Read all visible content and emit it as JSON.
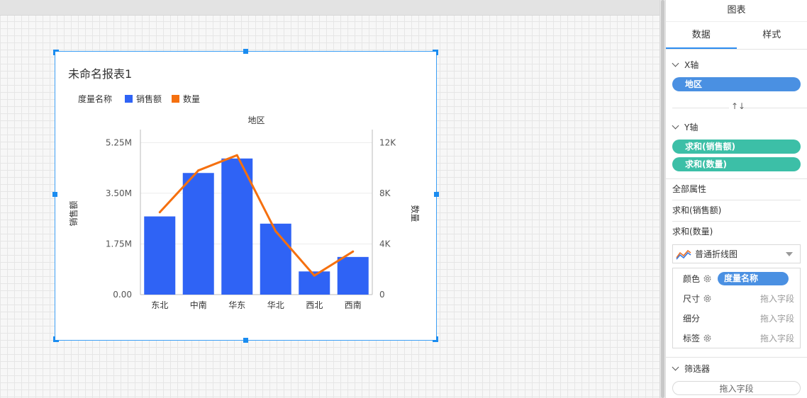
{
  "widget": {
    "title": "未命名报表1",
    "legend": {
      "title": "度量名称",
      "items": [
        {
          "label": "销售额",
          "color": "#2f63f5"
        },
        {
          "label": "数量",
          "color": "#f5700f"
        }
      ]
    }
  },
  "chart_data": {
    "type": "bar",
    "title": "地区",
    "categories": [
      "东北",
      "中南",
      "华东",
      "华北",
      "西北",
      "西南"
    ],
    "series": [
      {
        "name": "销售额",
        "type": "bar",
        "axis": "left",
        "color": "#2f63f5",
        "values": [
          2700000,
          4200000,
          4700000,
          2450000,
          800000,
          1300000
        ]
      },
      {
        "name": "数量",
        "type": "line",
        "axis": "right",
        "color": "#f5700f",
        "values": [
          6500,
          9800,
          11000,
          5000,
          1500,
          3400
        ]
      }
    ],
    "ylabel": "销售额",
    "y2label": "数量",
    "ylim": [
      0,
      5600000
    ],
    "y2lim": [
      0,
      12800
    ],
    "yticks": [
      "0.00",
      "1.75M",
      "3.50M",
      "5.25M"
    ],
    "ytick_values": [
      0,
      1750000,
      3500000,
      5250000
    ],
    "y2ticks": [
      "0",
      "4K",
      "8K",
      "12K"
    ],
    "y2tick_values": [
      0,
      4000,
      8000,
      12000
    ],
    "grid": true
  },
  "panel": {
    "title": "图表",
    "tabs": [
      {
        "label": "数据",
        "active": true
      },
      {
        "label": "样式",
        "active": false
      }
    ],
    "x_axis": {
      "label": "X轴",
      "fields": [
        "地区"
      ]
    },
    "swap_symbol": "↑↓",
    "y_axis": {
      "label": "Y轴",
      "fields": [
        "求和(销售额)",
        "求和(数量)"
      ]
    },
    "properties": [
      "全部属性",
      "求和(销售额)",
      "求和(数量)"
    ],
    "chart_type_select": "普通折线图",
    "marks": {
      "color_label": "颜色",
      "color_field": "度量名称",
      "size_label": "尺寸",
      "detail_label": "细分",
      "tag_label": "标签",
      "drop_placeholder": "拖入字段"
    },
    "filter": {
      "label": "筛选器",
      "placeholder": "拖入字段"
    }
  }
}
